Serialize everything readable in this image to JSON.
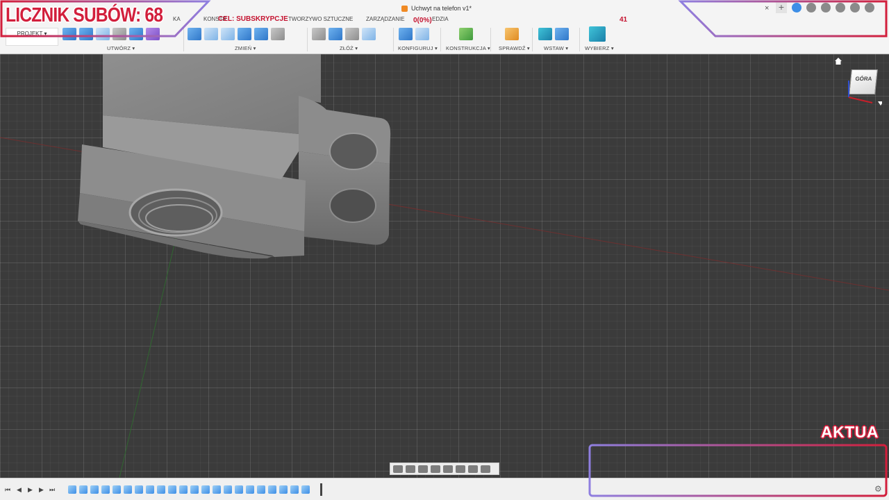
{
  "app": {
    "document_title": "Uchwyt na telefon v1*",
    "close_tab": "×",
    "new_tab": "+"
  },
  "menu_tabs": [
    {
      "label": "KONSTR"
    },
    {
      "label": "TWORZYWO SZTUCZNE"
    },
    {
      "label": "ZARZĄDZANIE"
    },
    {
      "label": "EDZIA"
    },
    {
      "label": "KA"
    }
  ],
  "project_button": "PROJEKT ▾",
  "toolbar_groups": [
    {
      "label": "UTWÓRZ ▾"
    },
    {
      "label": "ZMIEŃ ▾"
    },
    {
      "label": "ZŁÓŻ ▾"
    },
    {
      "label": "KONFIGURUJ ▾"
    },
    {
      "label": "KONSTRUKCJA ▾"
    },
    {
      "label": "SPRAWDŹ ▾"
    },
    {
      "label": "WSTAW ▾"
    },
    {
      "label": "WYBIERZ ▾"
    }
  ],
  "viewcube": {
    "face_label": "GÓRA"
  },
  "overlay": {
    "sub_counter": "LICZNIK SUBÓW: 68",
    "goal_label": "CEL: SUBSKRYPCJE",
    "goal_percent": "0(0%)",
    "goal_value": "41",
    "news_label": "AKTUA"
  },
  "timeline": {
    "first": "⏮",
    "prev": "◀",
    "play": "▶",
    "next": "▶",
    "last": "⏭",
    "settings": "⚙"
  },
  "colors": {
    "overlay_red": "#d21f3c",
    "overlay_purple": "#8f7fe0",
    "accent_blue": "#3d8ee6",
    "viewport_bg": "#3b3b3b"
  }
}
